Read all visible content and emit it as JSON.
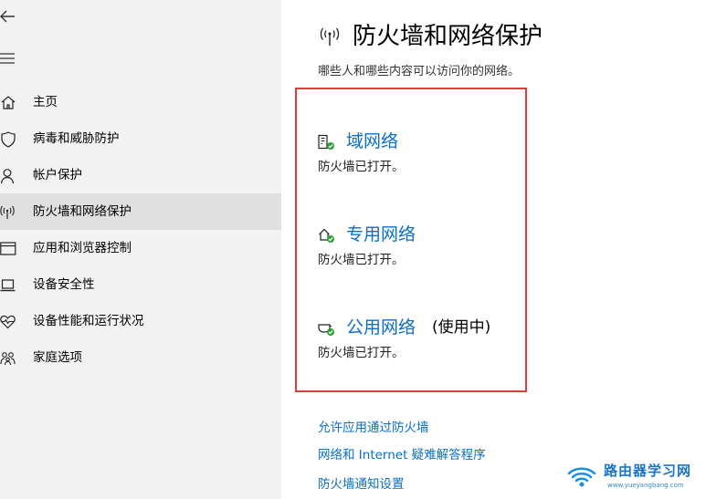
{
  "sidebar": {
    "items": [
      {
        "label": "主页",
        "icon": "home-icon"
      },
      {
        "label": "病毒和威胁防护",
        "icon": "shield-icon"
      },
      {
        "label": "帐户保护",
        "icon": "person-icon"
      },
      {
        "label": "防火墙和网络保护",
        "icon": "antenna-icon",
        "active": true
      },
      {
        "label": "应用和浏览器控制",
        "icon": "browser-window-icon"
      },
      {
        "label": "设备安全性",
        "icon": "laptop-icon"
      },
      {
        "label": "设备性能和运行状况",
        "icon": "heart-pulse-icon"
      },
      {
        "label": "家庭选项",
        "icon": "family-icon"
      }
    ]
  },
  "main": {
    "title": "防火墙和网络保护",
    "subtitle": "哪些人和哪些内容可以访问你的网络。",
    "networks": [
      {
        "name": "域网络",
        "tag": "",
        "status": "防火墙已打开。",
        "icon": "domain-network-icon"
      },
      {
        "name": "专用网络",
        "tag": "",
        "status": "防火墙已打开。",
        "icon": "private-network-icon"
      },
      {
        "name": "公用网络",
        "tag": "(使用中)",
        "status": "防火墙已打开。",
        "icon": "public-network-icon"
      }
    ],
    "links": [
      "允许应用通过防火墙",
      "网络和 Internet 疑难解答程序",
      "防火墙通知设置"
    ]
  },
  "watermark": {
    "text": "路由器学习网",
    "url": "www.yueyangbang.com"
  },
  "colors": {
    "accent": "#0b6ec7",
    "sidebar_bg": "#f2f2f2",
    "sidebar_active": "#e0e0e0",
    "highlight_border": "#e03c3c",
    "status_ok": "#2e9e3a"
  }
}
